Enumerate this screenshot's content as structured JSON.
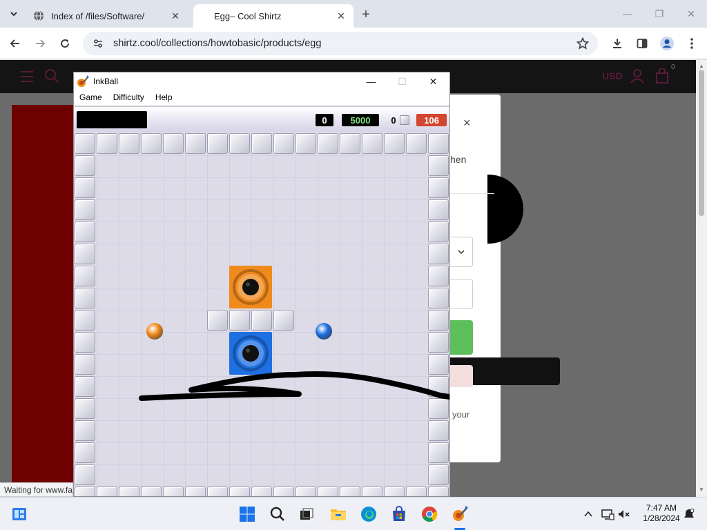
{
  "browser": {
    "tabs": [
      {
        "title": "Index of /files/Software/",
        "active": false
      },
      {
        "title": "Egg– Cool Shirtz",
        "active": true
      }
    ],
    "url": "shirtz.cool/collections/howtobasic/products/egg",
    "status_text": "Waiting for www.fa"
  },
  "site": {
    "currency": "USD",
    "cart_count": "0",
    "modal": {
      "close": "×",
      "text_fragment_1": "hen",
      "text_fragment_2": "your"
    }
  },
  "inkball": {
    "title": "InkBall",
    "menu": [
      "Game",
      "Difficulty",
      "Help"
    ],
    "score": "0",
    "bonus": "5000",
    "lives": "0",
    "timer": "106",
    "colors": {
      "orange": "#f08a1c",
      "blue": "#1e6fe0",
      "timer_bg": "#d2452e",
      "bonus_text": "#7ee07e"
    }
  },
  "taskbar": {
    "time": "7:47 AM",
    "date": "1/28/2024",
    "icons": [
      "widgets-icon",
      "start-icon",
      "search-icon",
      "task-view-icon",
      "file-explorer-icon",
      "edge-icon",
      "store-icon",
      "chrome-icon",
      "inkball-icon"
    ]
  }
}
